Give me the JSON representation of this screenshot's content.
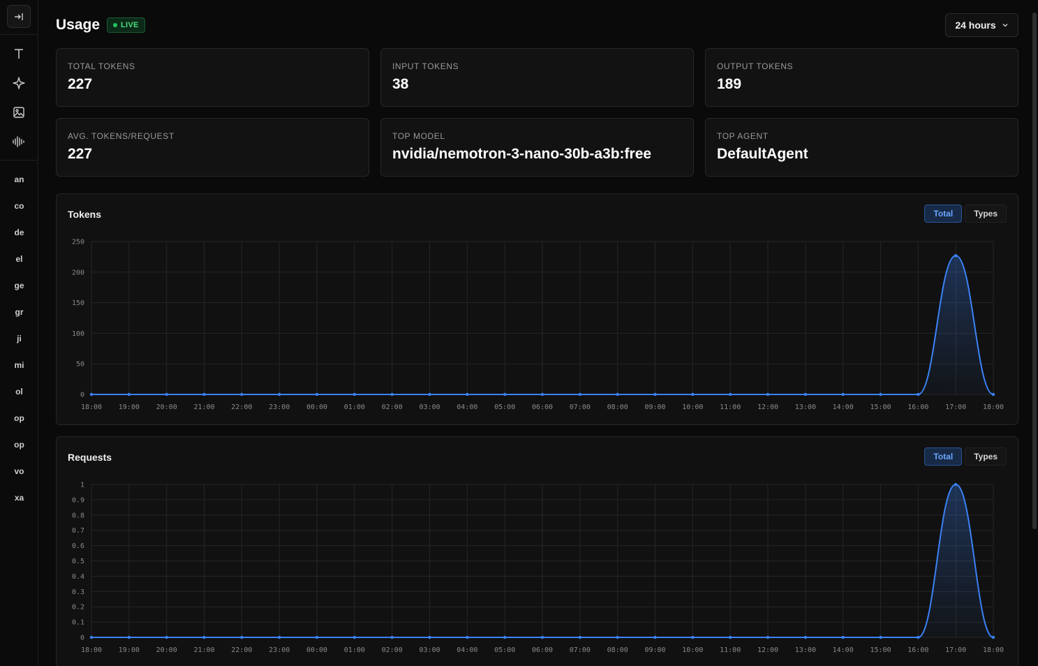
{
  "sidebar": {
    "items": [
      "an",
      "co",
      "de",
      "el",
      "ge",
      "gr",
      "ji",
      "mi",
      "ol",
      "op",
      "op",
      "vo",
      "xa"
    ],
    "icons": [
      "collapse-sidebar-icon",
      "text-icon",
      "sparkle-icon",
      "image-icon",
      "audio-wave-icon"
    ]
  },
  "header": {
    "title": "Usage",
    "badge": "LIVE",
    "range": "24 hours"
  },
  "stats": [
    {
      "label": "TOTAL TOKENS",
      "value": "227"
    },
    {
      "label": "INPUT TOKENS",
      "value": "38"
    },
    {
      "label": "OUTPUT TOKENS",
      "value": "189"
    },
    {
      "label": "AVG. TOKENS/REQUEST",
      "value": "227"
    },
    {
      "label": "TOP MODEL",
      "value": "nvidia/nemotron-3-nano-30b-a3b:free"
    },
    {
      "label": "TOP AGENT",
      "value": "DefaultAgent"
    }
  ],
  "colors": {
    "accent": "#3b82f6",
    "live": "#22c55e"
  },
  "chart_data": [
    {
      "type": "area",
      "title": "Tokens",
      "toggle": {
        "active": "Total",
        "inactive": "Types"
      },
      "x": [
        "18:00",
        "19:00",
        "20:00",
        "21:00",
        "22:00",
        "23:00",
        "00:00",
        "01:00",
        "02:00",
        "03:00",
        "04:00",
        "05:00",
        "06:00",
        "07:00",
        "08:00",
        "09:00",
        "10:00",
        "11:00",
        "12:00",
        "13:00",
        "14:00",
        "15:00",
        "16:00",
        "17:00",
        "18:00"
      ],
      "values": [
        0,
        0,
        0,
        0,
        0,
        0,
        0,
        0,
        0,
        0,
        0,
        0,
        0,
        0,
        0,
        0,
        0,
        0,
        0,
        0,
        0,
        0,
        0,
        227,
        0
      ],
      "yticks": [
        "0",
        "50",
        "100",
        "150",
        "200",
        "250"
      ],
      "ylim": [
        0,
        250
      ],
      "grid": true
    },
    {
      "type": "area",
      "title": "Requests",
      "toggle": {
        "active": "Total",
        "inactive": "Types"
      },
      "x": [
        "18:00",
        "19:00",
        "20:00",
        "21:00",
        "22:00",
        "23:00",
        "00:00",
        "01:00",
        "02:00",
        "03:00",
        "04:00",
        "05:00",
        "06:00",
        "07:00",
        "08:00",
        "09:00",
        "10:00",
        "11:00",
        "12:00",
        "13:00",
        "14:00",
        "15:00",
        "16:00",
        "17:00",
        "18:00"
      ],
      "values": [
        0,
        0,
        0,
        0,
        0,
        0,
        0,
        0,
        0,
        0,
        0,
        0,
        0,
        0,
        0,
        0,
        0,
        0,
        0,
        0,
        0,
        0,
        0,
        1,
        0
      ],
      "yticks": [
        "0",
        "0.1",
        "0.2",
        "0.3",
        "0.4",
        "0.5",
        "0.6",
        "0.7",
        "0.8",
        "0.9",
        "1"
      ],
      "ylim": [
        0,
        1
      ],
      "grid": true
    }
  ]
}
